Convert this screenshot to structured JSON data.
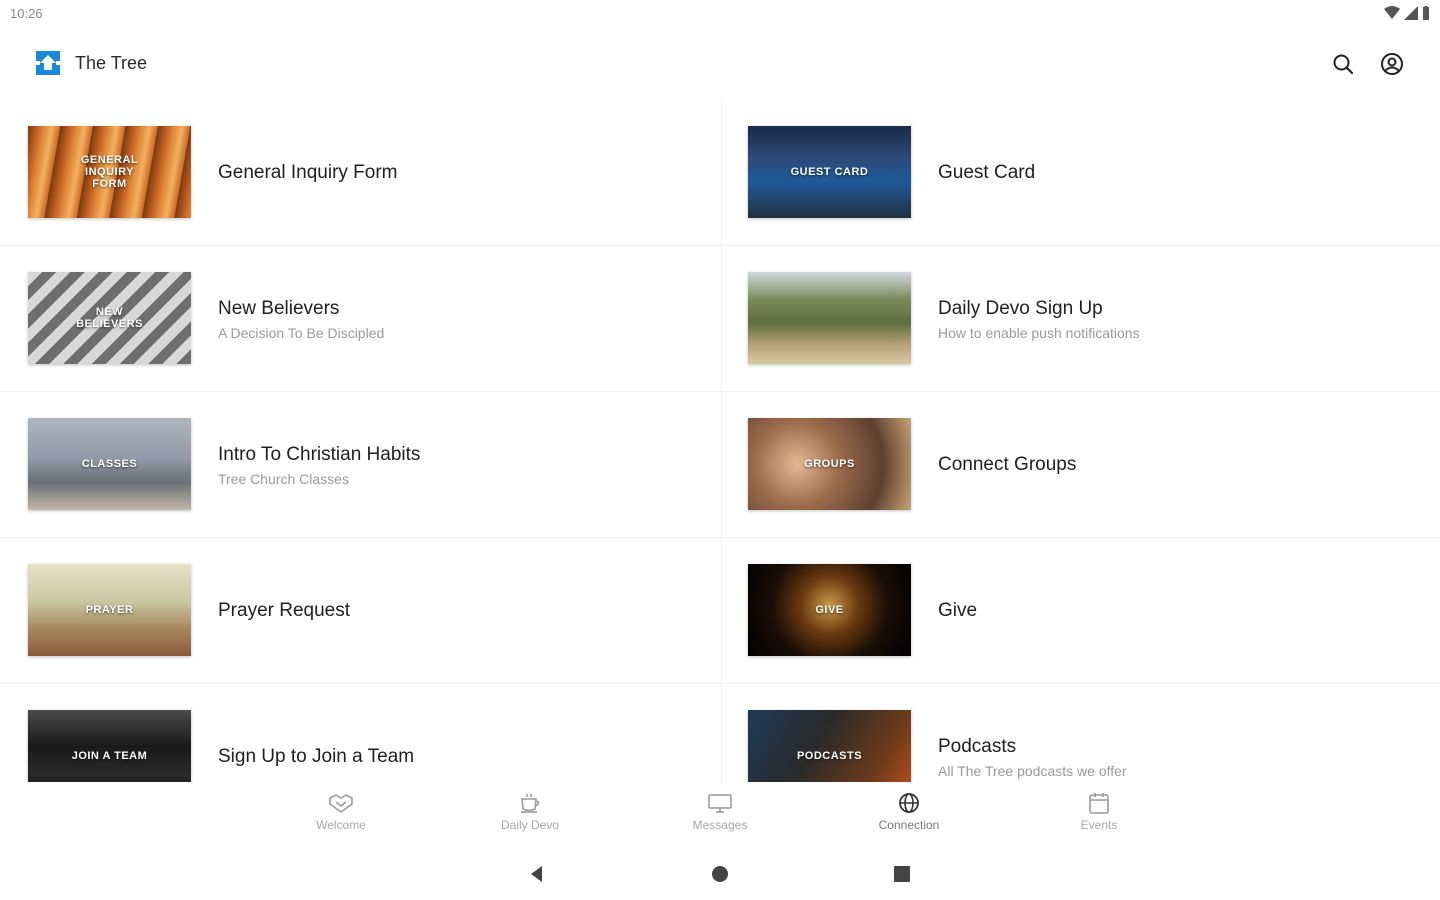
{
  "status_bar": {
    "time": "10:26",
    "icons": [
      "wifi-icon",
      "signal-icon",
      "battery-icon"
    ]
  },
  "app_bar": {
    "title": "The Tree",
    "logo_icon": "tree-logo-icon",
    "actions": [
      "search-icon",
      "account-icon"
    ]
  },
  "cards": [
    {
      "title": "General Inquiry Form",
      "subtitle": "",
      "thumb_label": "GENERAL INQUIRY FORM"
    },
    {
      "title": "Guest Card",
      "subtitle": "",
      "thumb_label": "GUEST CARD"
    },
    {
      "title": "New Believers",
      "subtitle": "A Decision To Be Discipled",
      "thumb_label": "NEW BELIEVERS"
    },
    {
      "title": "Daily Devo Sign Up",
      "subtitle": "How to enable push notifications",
      "thumb_label": ""
    },
    {
      "title": "Intro To Christian Habits",
      "subtitle": "Tree Church Classes",
      "thumb_label": "CLASSES"
    },
    {
      "title": "Connect Groups",
      "subtitle": "",
      "thumb_label": "GROUPS"
    },
    {
      "title": "Prayer Request",
      "subtitle": "",
      "thumb_label": "PRAYER"
    },
    {
      "title": "Give",
      "subtitle": "",
      "thumb_label": "GIVE"
    },
    {
      "title": "Sign Up to Join a Team",
      "subtitle": "",
      "thumb_label": "JOIN A TEAM"
    },
    {
      "title": "Podcasts",
      "subtitle": "All The Tree podcasts we offer",
      "thumb_label": "PODCASTS"
    }
  ],
  "bottom_nav": [
    {
      "label": "Welcome",
      "icon": "handshake-icon"
    },
    {
      "label": "Daily Devo",
      "icon": "coffee-cup-icon"
    },
    {
      "label": "Messages",
      "icon": "monitor-icon"
    },
    {
      "label": "Connection",
      "icon": "globe-icon",
      "active": true
    },
    {
      "label": "Events",
      "icon": "calendar-icon"
    }
  ],
  "system_nav": [
    "back-icon",
    "home-icon",
    "recents-icon"
  ],
  "colors": {
    "accent_blue": "#1a8ad8",
    "text_primary": "#1f1f1f",
    "text_secondary": "#9a9a9a"
  }
}
